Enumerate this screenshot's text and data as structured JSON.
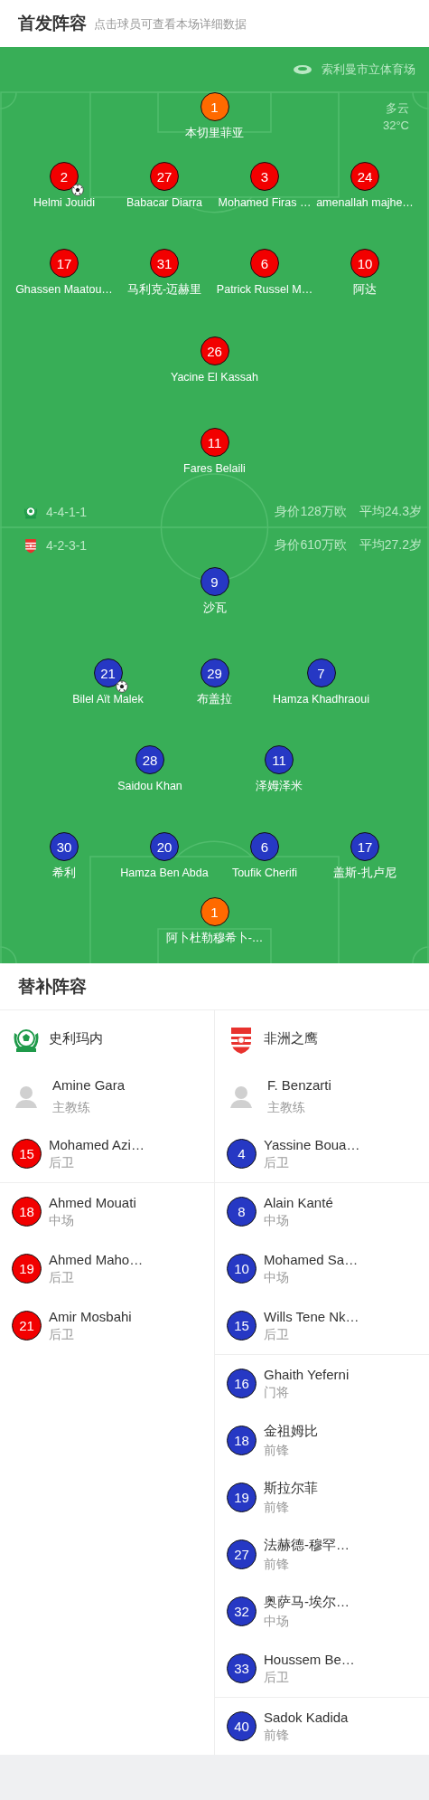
{
  "header": {
    "title": "首发阵容",
    "subtitle": "点击球员可查看本场详细数据"
  },
  "pitch": {
    "stadium": "索利曼市立体育场",
    "weather": "多云",
    "temperature": "32°C",
    "home": {
      "formation": "4-4-1-1",
      "value": "身价128万欧",
      "avg_age": "平均24.3岁",
      "lines": [
        {
          "players": [
            {
              "number": "1",
              "name": "本切里菲亚",
              "color": "#ff6a00",
              "scored": false
            }
          ]
        },
        {
          "players": [
            {
              "number": "2",
              "name": "Helmi Jouidi",
              "color": "#f20000",
              "scored": true
            },
            {
              "number": "27",
              "name": "Babacar Diarra",
              "color": "#f20000",
              "scored": false
            },
            {
              "number": "3",
              "name": "Mohamed Firas …",
              "color": "#f20000",
              "scored": false
            },
            {
              "number": "24",
              "name": "amenallah majhe…",
              "color": "#f20000",
              "scored": false
            }
          ]
        },
        {
          "players": [
            {
              "number": "17",
              "name": "Ghassen Maatou…",
              "color": "#f20000",
              "scored": false
            },
            {
              "number": "31",
              "name": "马利克-迈赫里",
              "color": "#f20000",
              "scored": false
            },
            {
              "number": "6",
              "name": "Patrick Russel M…",
              "color": "#f20000",
              "scored": false
            },
            {
              "number": "10",
              "name": "阿达",
              "color": "#f20000",
              "scored": false
            }
          ]
        },
        {
          "players": [
            {
              "number": "26",
              "name": "Yacine El Kassah",
              "color": "#f20000",
              "scored": false
            }
          ]
        },
        {
          "players": [
            {
              "number": "11",
              "name": "Fares Belaili",
              "color": "#f20000",
              "scored": false
            }
          ]
        }
      ]
    },
    "away": {
      "formation": "4-2-3-1",
      "value": "身价610万欧",
      "avg_age": "平均27.2岁",
      "lines": [
        {
          "players": [
            {
              "number": "9",
              "name": "沙瓦",
              "color": "#2638c4",
              "scored": false
            }
          ]
        },
        {
          "players": [
            {
              "number": "21",
              "name": "Bilel Aït Malek",
              "color": "#2638c4",
              "scored": true
            },
            {
              "number": "29",
              "name": "布盖拉",
              "color": "#2638c4",
              "scored": false
            },
            {
              "number": "7",
              "name": "Hamza Khadhraoui",
              "color": "#2638c4",
              "scored": false
            }
          ]
        },
        {
          "players": [
            {
              "number": "28",
              "name": "Saidou Khan",
              "color": "#2638c4",
              "scored": false
            },
            {
              "number": "11",
              "name": "泽姆泽米",
              "color": "#2638c4",
              "scored": false
            }
          ]
        },
        {
          "players": [
            {
              "number": "30",
              "name": "希利",
              "color": "#2638c4",
              "scored": false
            },
            {
              "number": "20",
              "name": "Hamza Ben Abda",
              "color": "#2638c4",
              "scored": false
            },
            {
              "number": "6",
              "name": "Toufik Cherifi",
              "color": "#2638c4",
              "scored": false
            },
            {
              "number": "17",
              "name": "盖斯-扎卢尼",
              "color": "#2638c4",
              "scored": false
            }
          ]
        },
        {
          "players": [
            {
              "number": "1",
              "name": "阿卜杜勒穆希卜-…",
              "color": "#ff6a00",
              "scored": false
            }
          ]
        }
      ]
    }
  },
  "substitutes": {
    "title": "替补阵容",
    "teams": [
      {
        "name": "史利玛内",
        "kind": "home",
        "color": "#f20000",
        "coach": {
          "name": "Amine Gara",
          "role": "主教练"
        },
        "groups": [
          {
            "players": [
              {
                "number": "15",
                "name": "Mohamed Azi…",
                "position": "后卫"
              }
            ]
          },
          {
            "players": [
              {
                "number": "18",
                "name": "Ahmed Mouati",
                "position": "中场"
              },
              {
                "number": "19",
                "name": "Ahmed Maho…",
                "position": "后卫"
              },
              {
                "number": "21",
                "name": "Amir Mosbahi",
                "position": "后卫"
              }
            ]
          }
        ]
      },
      {
        "name": "非洲之鹰",
        "kind": "away",
        "color": "#2638c4",
        "coach": {
          "name": "F. Benzarti",
          "role": "主教练"
        },
        "groups": [
          {
            "players": [
              {
                "number": "4",
                "name": "Yassine Boua…",
                "position": "后卫"
              }
            ]
          },
          {
            "players": [
              {
                "number": "8",
                "name": "Alain Kanté",
                "position": "中场"
              },
              {
                "number": "10",
                "name": "Mohamed Sa…",
                "position": "中场"
              },
              {
                "number": "15",
                "name": "Wills Tene Nk…",
                "position": "后卫"
              }
            ]
          },
          {
            "players": [
              {
                "number": "16",
                "name": "Ghaith Yeferni",
                "position": "门将"
              },
              {
                "number": "18",
                "name": "金祖姆比",
                "position": "前锋"
              },
              {
                "number": "19",
                "name": "斯拉尔菲",
                "position": "前锋"
              },
              {
                "number": "27",
                "name": "法赫德-穆罕…",
                "position": "前锋"
              },
              {
                "number": "32",
                "name": "奥萨马-埃尔…",
                "position": "中场"
              },
              {
                "number": "33",
                "name": "Houssem Be…",
                "position": "后卫"
              }
            ]
          },
          {
            "players": [
              {
                "number": "40",
                "name": "Sadok Kadida",
                "position": "前锋"
              }
            ]
          }
        ]
      }
    ]
  }
}
